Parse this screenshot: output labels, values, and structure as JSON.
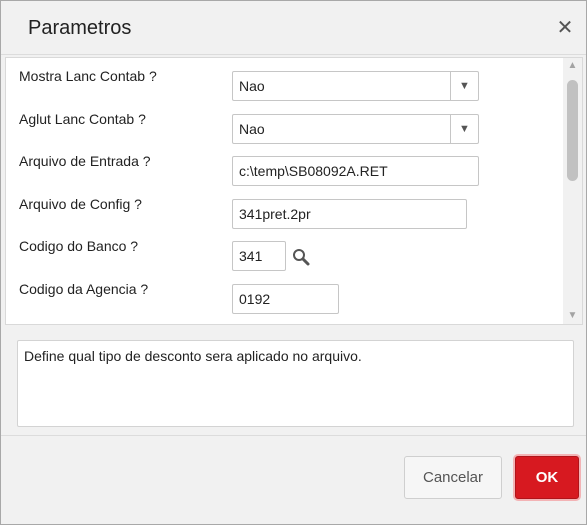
{
  "dialog": {
    "title": "Parametros",
    "close_label": "✕"
  },
  "fields": [
    {
      "label": "Mostra Lanc Contab ?",
      "value": "Nao",
      "type": "select"
    },
    {
      "label": "Aglut Lanc Contab ?",
      "value": "Nao",
      "type": "select"
    },
    {
      "label": "Arquivo de Entrada ?",
      "value": "c:\\temp\\SB08092A.RET",
      "type": "text"
    },
    {
      "label": "Arquivo de Config ?",
      "value": "341pret.2pr",
      "type": "text"
    },
    {
      "label": "Codigo do Banco ?",
      "value": "341",
      "type": "lookup"
    },
    {
      "label": "Codigo da Agencia ?",
      "value": "0192",
      "type": "text"
    }
  ],
  "description": "Define qual tipo de desconto sera aplicado no arquivo.",
  "buttons": {
    "cancel": "Cancelar",
    "ok": "OK"
  },
  "colors": {
    "ok_button": "#d71920",
    "background": "#f1f1f1"
  },
  "icons": {
    "lookup": "search-icon",
    "dropdown": "chevron-down-icon",
    "close": "close-icon"
  }
}
